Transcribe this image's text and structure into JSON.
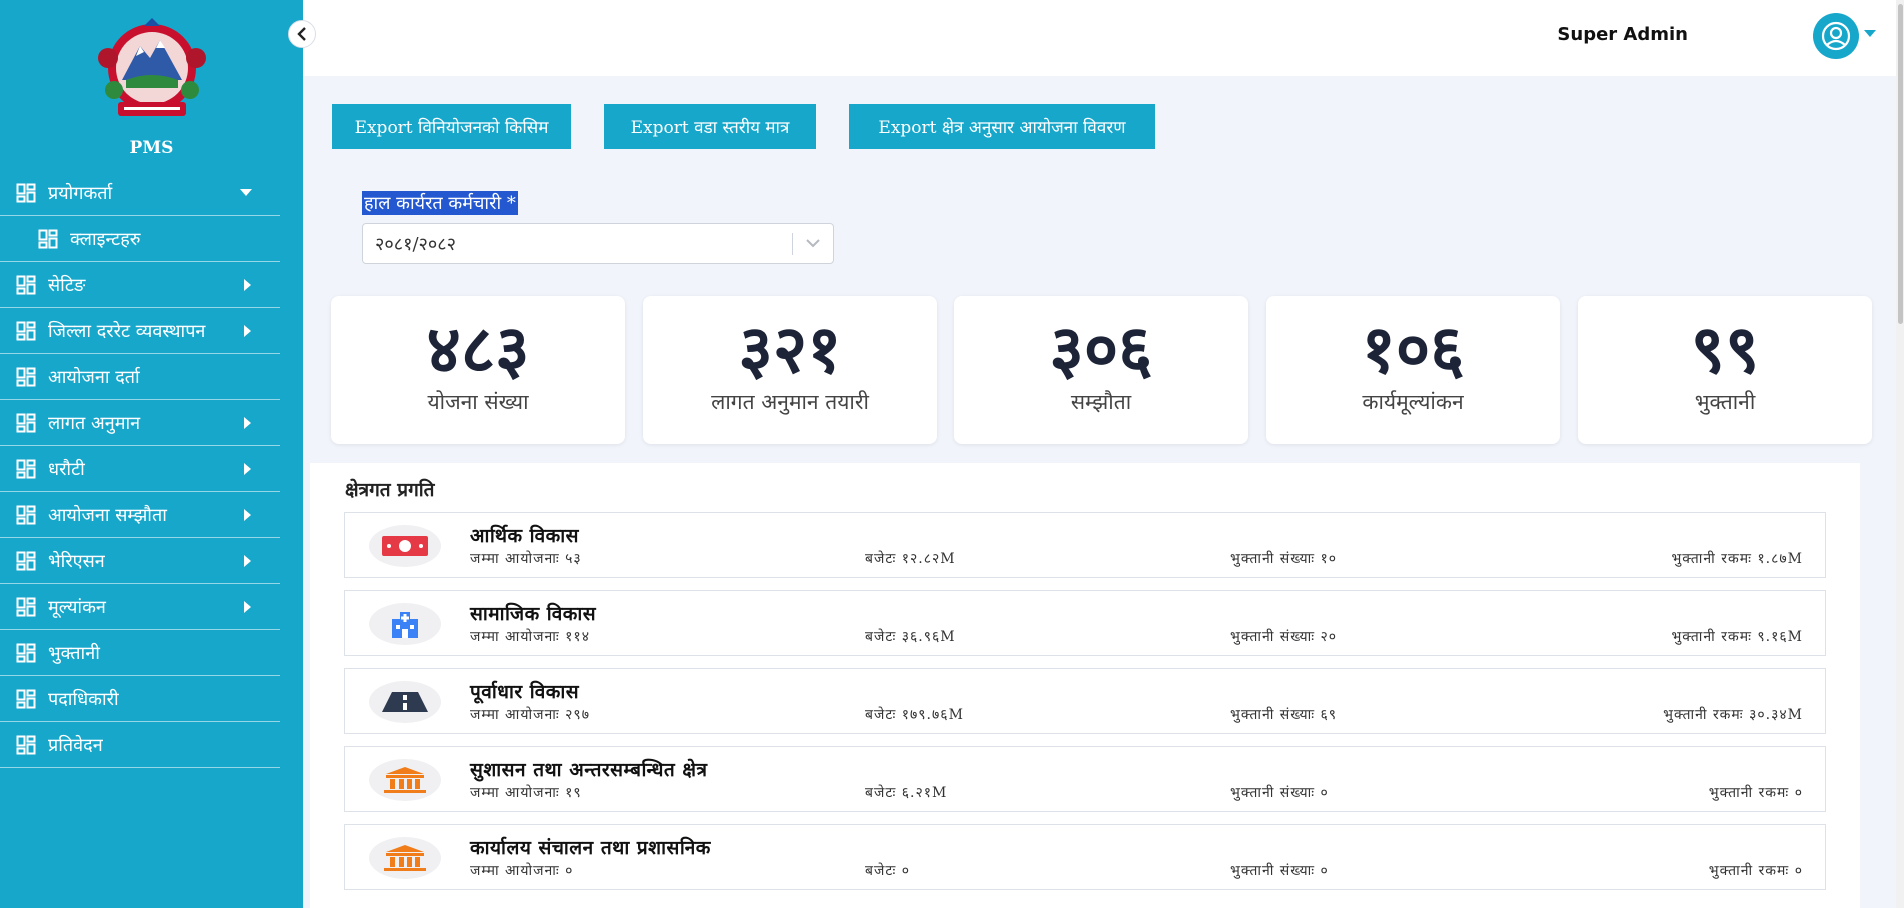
{
  "sidebar": {
    "app_name": "PMS",
    "items": [
      {
        "label": "प्रयोगकर्ता",
        "arrow": "down"
      },
      {
        "label": "क्लाइन्टहरु",
        "sub": true
      },
      {
        "label": "सेटिङ",
        "arrow": "right"
      },
      {
        "label": "जिल्ला दररेट व्यवस्थापन",
        "arrow": "right"
      },
      {
        "label": "आयोजना दर्ता"
      },
      {
        "label": "लागत अनुमान",
        "arrow": "right"
      },
      {
        "label": "धरौटी",
        "arrow": "right"
      },
      {
        "label": "आयोजना सम्झौता",
        "arrow": "right"
      },
      {
        "label": "भेरिएसन",
        "arrow": "right"
      },
      {
        "label": "मूल्यांकन",
        "arrow": "right"
      },
      {
        "label": "भुक्तानी"
      },
      {
        "label": "पदाधिकारी"
      },
      {
        "label": "प्रतिवेदन"
      }
    ]
  },
  "header": {
    "user_name": "Super Admin"
  },
  "exports": [
    "Export विनियोजनको किसिम",
    "Export वडा स्तरीय मात्र",
    "Export क्षेत्र अनुसार आयोजना विवरण"
  ],
  "filter": {
    "label": "हाल कार्यरत कर्मचारी *",
    "value": "२०८१/२०८२"
  },
  "stats": [
    {
      "value": "४८३",
      "label": "योजना संख्या"
    },
    {
      "value": "३२१",
      "label": "लागत अनुमान तयारी"
    },
    {
      "value": "३०६",
      "label": "सम्झौता"
    },
    {
      "value": "१०६",
      "label": "कार्यमूल्यांकन"
    },
    {
      "value": "९९",
      "label": "भुक्तानी"
    }
  ],
  "progress": {
    "title": "क्षेत्रगत प्रगति",
    "sectors": [
      {
        "name": "आर्थिक विकास",
        "icon": "money-icon",
        "icon_color": "#e63946",
        "projects": "जम्मा आयोजनाः ५३",
        "budget": "बजेटः १२.८२M",
        "payment_count": "भुक्तानी संख्याः १०",
        "payment_amount": "भुक्तानी रकमः १.८७M"
      },
      {
        "name": "सामाजिक विकास",
        "icon": "hospital-icon",
        "icon_color": "#3b82f6",
        "projects": "जम्मा आयोजनाः ११४",
        "budget": "बजेटः ३६.९६M",
        "payment_count": "भुक्तानी संख्याः २०",
        "payment_amount": "भुक्तानी रकमः ९.१६M"
      },
      {
        "name": "पूर्वाधार विकास",
        "icon": "road-icon",
        "icon_color": "#2d3a4f",
        "projects": "जम्मा आयोजनाः २९७",
        "budget": "बजेटः १७९.७६M",
        "payment_count": "भुक्तानी संख्याः ६९",
        "payment_amount": "भुक्तानी रकमः ३०.३४M"
      },
      {
        "name": "सुशासन तथा अन्तरसम्बन्धित क्षेत्र",
        "icon": "institution-icon",
        "icon_color": "#f07c1a",
        "projects": "जम्मा आयोजनाः १९",
        "budget": "बजेटः ६.२१M",
        "payment_count": "भुक्तानी संख्याः ०",
        "payment_amount": "भुक्तानी रकमः ०"
      },
      {
        "name": "कार्यालय संचालन तथा प्रशासनिक",
        "icon": "institution-icon",
        "icon_color": "#f07c1a",
        "projects": "जम्मा आयोजनाः ०",
        "budget": "बजेटः ०",
        "payment_count": "भुक्तानी संख्याः ०",
        "payment_amount": "भुक्तानी रकमः ०"
      }
    ]
  },
  "colors": {
    "accent": "#17a7cb",
    "selection": "#2358d1"
  }
}
